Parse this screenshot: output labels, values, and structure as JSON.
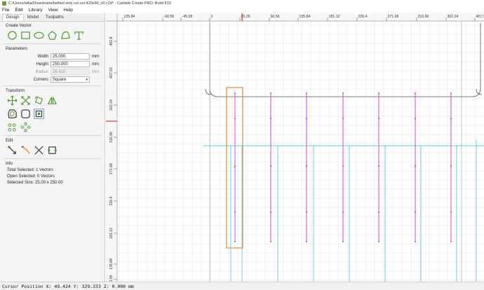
{
  "window": {
    "title": "C:/Users/wilia/Downloads/bellied sink cut out 420x90_v0.c2d* - Carbide Create PRO: Build 813"
  },
  "menu": [
    "File",
    "Edit",
    "Library",
    "View",
    "Help"
  ],
  "tabs": [
    "Design",
    "Model",
    "Toolpaths"
  ],
  "sections": {
    "create_vector": "Create Vector",
    "parameters": "Parameters",
    "transform": "Transform",
    "edit": "Edit",
    "info": "Info"
  },
  "params": {
    "width_label": "Width",
    "width_value": "25.000",
    "width_unit": "mm",
    "height_label": "Height",
    "height_value": "250.000",
    "height_unit": "mm",
    "radius_label": "Radius",
    "radius_value": "26.420",
    "radius_unit": "mm",
    "corners_label": "Corners",
    "corners_value": "Square"
  },
  "info": {
    "total_selected": "Total Selected:  1 Vectors",
    "open_selected": "Open Selected:  0 Vectors",
    "selected_size": "Selected Size:  25.00 x 250.00"
  },
  "ruler": {
    "top": [
      "135.84",
      "-90.56",
      "-45.28",
      "0",
      "45.28",
      "90.56",
      "135.84",
      "181.12",
      "226.4",
      "271.68",
      "316.96",
      "362.24",
      "407.52"
    ],
    "left": [
      "452.8",
      "407.52",
      "362.24",
      "316.96",
      "271.68",
      "226.4",
      "181.12",
      "135.84",
      "90.56"
    ]
  },
  "status": {
    "cursor": "Cursor Position X: 49.424 Y: 329.333 Z: 0.000 mm"
  },
  "colors": {
    "accent_green": "#4f9a2f",
    "selection_orange": "#e08a3a",
    "vector_magenta": "#e040e0",
    "guide_cyan": "#5ec8e0",
    "origin_red": "#e03030"
  }
}
